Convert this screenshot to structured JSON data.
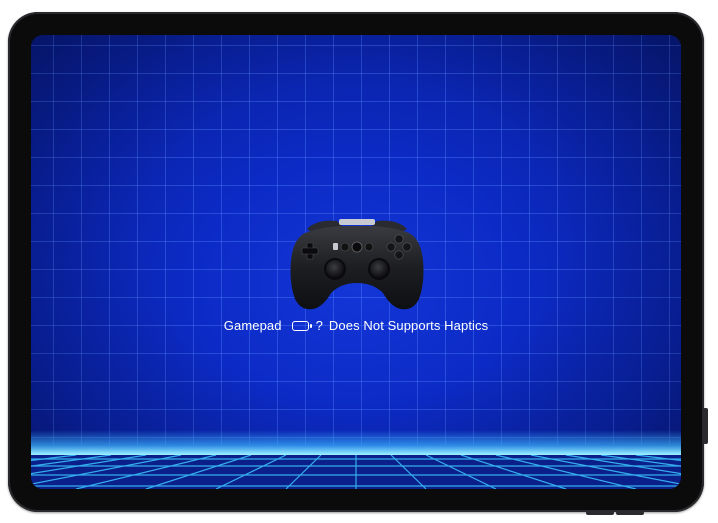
{
  "status": {
    "device_label": "Gamepad",
    "battery_icon": "battery-icon",
    "battery_value": "?",
    "haptics_text": "Does Not Supports Haptics"
  },
  "icons": {
    "controller": "gamepad-controller-image"
  },
  "colors": {
    "background": "#0c2bc6",
    "grid": "#5a8cff",
    "horizon_glow": "#8fe8ff",
    "text": "#ffffff"
  }
}
